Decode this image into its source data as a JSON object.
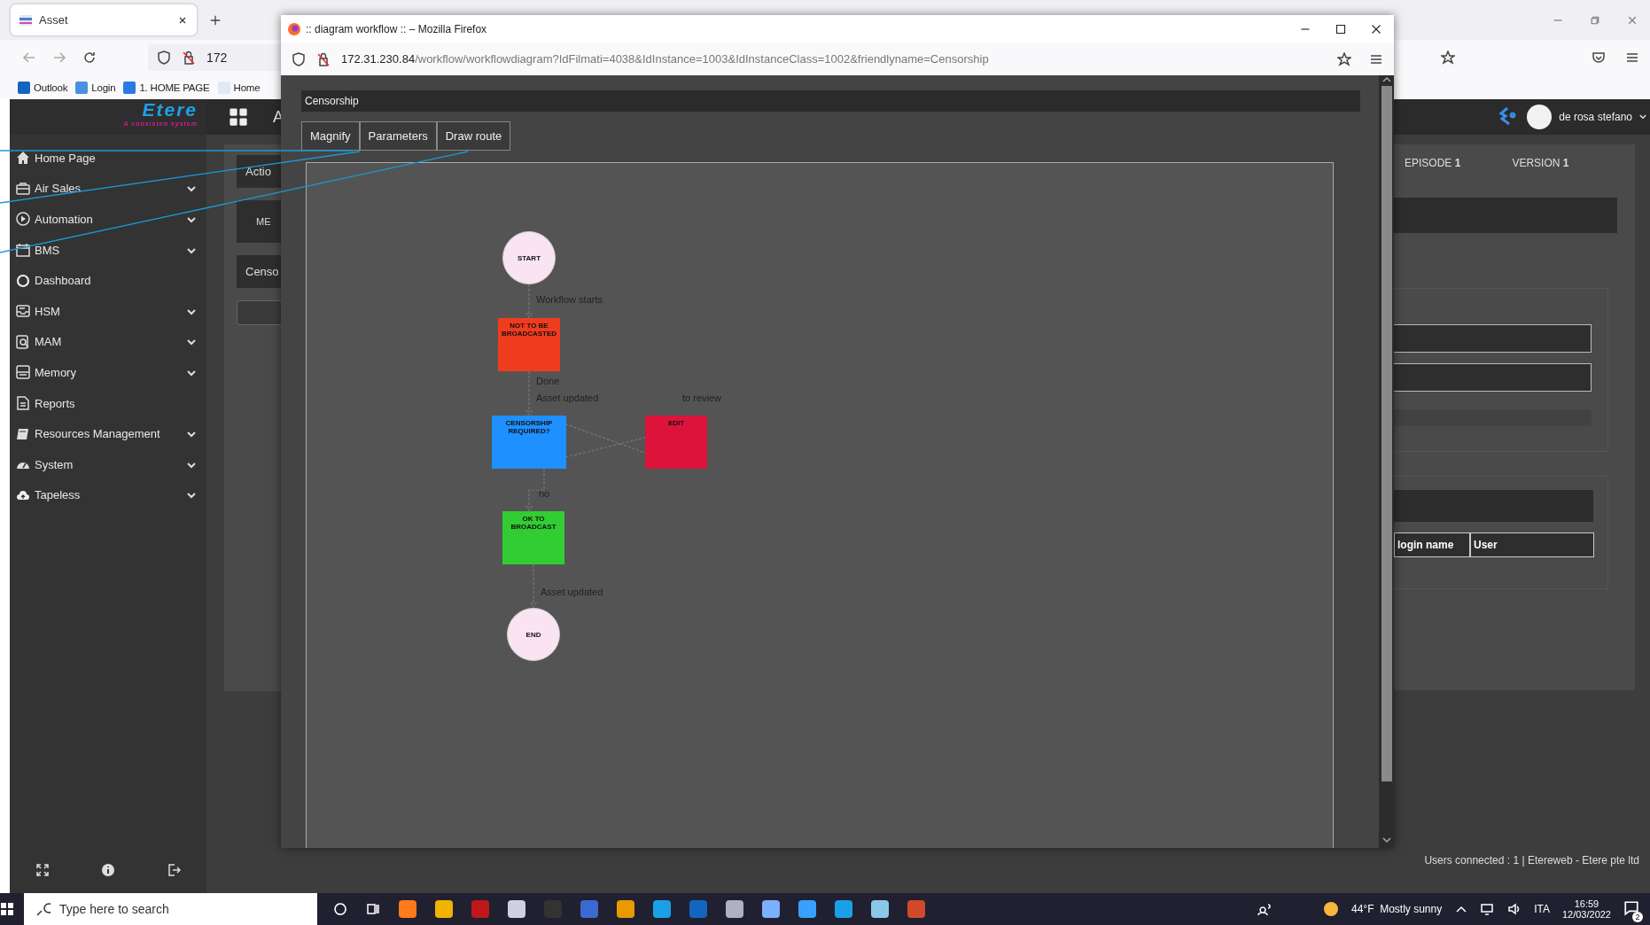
{
  "browser": {
    "tabs": [
      {
        "label": "Asset",
        "selected": true
      }
    ],
    "address": "172",
    "bookmarks": [
      "Outlook",
      "Login",
      "1. HOME PAGE",
      "Home"
    ]
  },
  "app": {
    "logo": "Etere",
    "tagline": "A consisten system",
    "header_text": "A",
    "user": "de rosa stefano",
    "sidebar": [
      {
        "label": "Home Page",
        "expandable": false
      },
      {
        "label": "Air Sales",
        "expandable": true
      },
      {
        "label": "Automation",
        "expandable": true
      },
      {
        "label": "BMS",
        "expandable": true
      },
      {
        "label": "Dashboard",
        "expandable": false
      },
      {
        "label": "HSM",
        "expandable": true
      },
      {
        "label": "MAM",
        "expandable": true
      },
      {
        "label": "Memory",
        "expandable": true
      },
      {
        "label": "Reports",
        "expandable": false
      },
      {
        "label": "Resources Management",
        "expandable": true
      },
      {
        "label": "System",
        "expandable": true
      },
      {
        "label": "Tapeless",
        "expandable": true
      }
    ],
    "left_texts": [
      "Actio",
      "ME",
      "Censo"
    ],
    "episode": "EPISODE **1**",
    "version": "VERSION **1**",
    "table_cells": [
      "login name",
      "User"
    ],
    "status": "Users connected : 1 | Etereweb - Etere pte ltd"
  },
  "popup": {
    "title": ":: diagram workflow :: – Mozilla Firefox",
    "url_host": "172.31.230.84",
    "url_path": "/workflow/workflowdiagram?IdFilmati=4038&IdInstance=1003&IdInstanceClass=1002&friendlyname=Censorship",
    "heading": "Censorship",
    "buttons": [
      "Magnify",
      "Parameters",
      "Draw route"
    ],
    "nodes": [
      {
        "kind": "circle",
        "label": "START",
        "color": "#fbe4f2"
      },
      {
        "kind": "box",
        "label": "NOT TO BE BROADCASTED",
        "color": "#f03c1e"
      },
      {
        "kind": "box",
        "label": "CENSORSHIP REQUIRED?",
        "color": "#1e90ff"
      },
      {
        "kind": "box",
        "label": "EDIT",
        "color": "#dc143c"
      },
      {
        "kind": "box",
        "label": "OK TO BROADCAST",
        "color": "#32cd32"
      },
      {
        "kind": "circle",
        "label": "END",
        "color": "#fbe4f2"
      }
    ],
    "edge_labels": [
      "Workflow starts",
      "Done",
      "Asset updated",
      "to review",
      "no",
      "Asset updated"
    ]
  },
  "taskbar": {
    "search_placeholder": "Type here to search",
    "weather": "44°F  Mostly sunny",
    "language": "ITA",
    "time": "16:59",
    "date": "12/03/2022",
    "notifications": "2"
  }
}
